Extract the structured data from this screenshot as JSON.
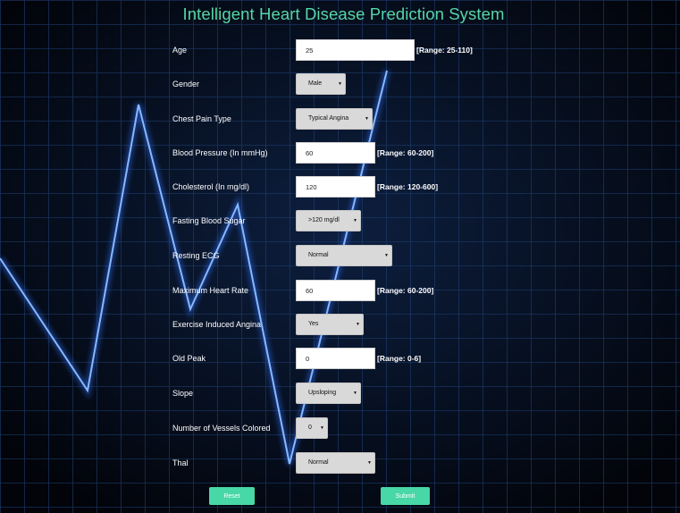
{
  "title": "Intelligent Heart Disease Prediction System",
  "colors": {
    "accent": "#48d7a7",
    "title": "#57d6a7",
    "background": "#03060d",
    "grid": "#1a3a6a",
    "ecg_line": "#5aa0ff"
  },
  "fields": {
    "age": {
      "label": "Age",
      "value": "25",
      "range": "[Range: 25-110]"
    },
    "gender": {
      "label": "Gender",
      "value": "Male"
    },
    "chest_pain": {
      "label": "Chest Pain Type",
      "value": "Typical Angina"
    },
    "blood_pressure": {
      "label": "Blood Pressure (In mmHg)",
      "value": "60",
      "range": "[Range: 60-200]"
    },
    "cholesterol": {
      "label": "Cholesterol (In mg/dl)",
      "value": "120",
      "range": "[Range: 120-600]"
    },
    "fasting_sugar": {
      "label": "Fasting Blood Sugar",
      "value": ">120 mg/dl"
    },
    "resting_ecg": {
      "label": "Resting ECG",
      "value": "Normal"
    },
    "max_heart_rate": {
      "label": "Maximum Heart Rate",
      "value": "60",
      "range": "[Range: 60-200]"
    },
    "exercise_angina": {
      "label": "Exercise Induced Angina",
      "value": "Yes"
    },
    "old_peak": {
      "label": "Old Peak",
      "value": "0",
      "range": "[Range: 0-6]"
    },
    "slope": {
      "label": "Slope",
      "value": "Upsloping"
    },
    "vessels": {
      "label": "Number of Vessels Colored",
      "value": "0"
    },
    "thal": {
      "label": "Thal",
      "value": "Normal"
    }
  },
  "buttons": {
    "reset": "Reset",
    "submit": "Submit"
  }
}
